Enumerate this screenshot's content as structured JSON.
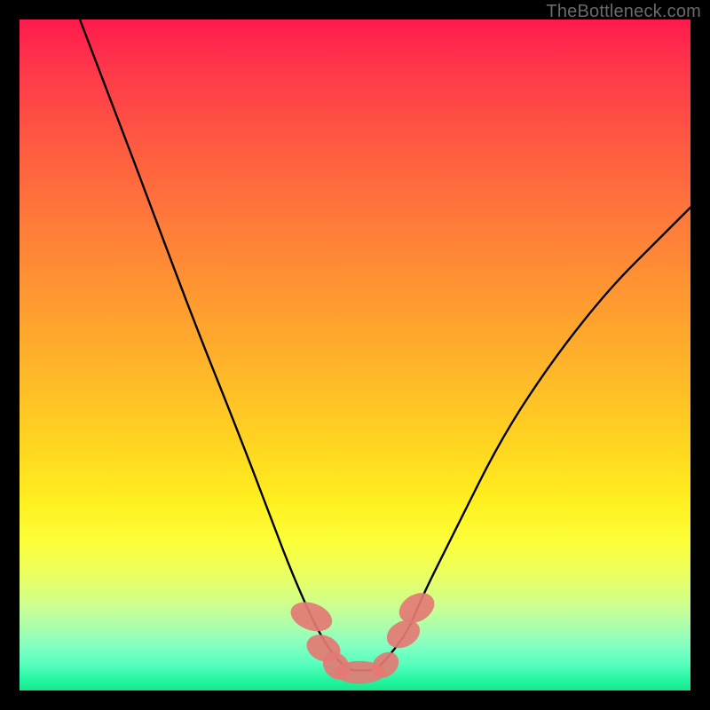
{
  "attribution": "TheBottleneck.com",
  "chart_data": {
    "type": "line",
    "title": "",
    "xlabel": "",
    "ylabel": "",
    "xlim": [
      0,
      100
    ],
    "ylim": [
      0,
      100
    ],
    "series": [
      {
        "name": "bottleneck-curve",
        "x": [
          9,
          14,
          20,
          26,
          32,
          37,
          40,
          43,
          45,
          47,
          49,
          51,
          53,
          55,
          58,
          60,
          65,
          72,
          80,
          88,
          95,
          100
        ],
        "y": [
          100,
          87,
          71,
          55,
          40,
          27,
          19,
          12,
          8,
          5,
          3,
          3,
          3,
          5,
          9,
          14,
          24,
          38,
          50,
          60,
          67,
          72
        ]
      }
    ],
    "markers": [
      {
        "x": 43.5,
        "y": 11,
        "rx": 2.0,
        "ry": 3.2,
        "angle": -70
      },
      {
        "x": 45.3,
        "y": 6.3,
        "rx": 1.9,
        "ry": 2.6,
        "angle": -68
      },
      {
        "x": 47.2,
        "y": 3.7,
        "rx": 1.8,
        "ry": 2.2,
        "angle": -40
      },
      {
        "x": 50.7,
        "y": 2.7,
        "rx": 1.7,
        "ry": 3.8,
        "angle": 90
      },
      {
        "x": 54.5,
        "y": 3.8,
        "rx": 1.7,
        "ry": 2.2,
        "angle": 50
      },
      {
        "x": 57.2,
        "y": 8.4,
        "rx": 1.9,
        "ry": 2.6,
        "angle": 62
      },
      {
        "x": 59.2,
        "y": 12.3,
        "rx": 2.0,
        "ry": 2.8,
        "angle": 60
      }
    ],
    "gradient_stops": [
      {
        "pos": 0,
        "color": "#ff1a4d"
      },
      {
        "pos": 0.5,
        "color": "#ffbb28"
      },
      {
        "pos": 0.78,
        "color": "#fcff3a"
      },
      {
        "pos": 1.0,
        "color": "#18e88f"
      }
    ]
  }
}
